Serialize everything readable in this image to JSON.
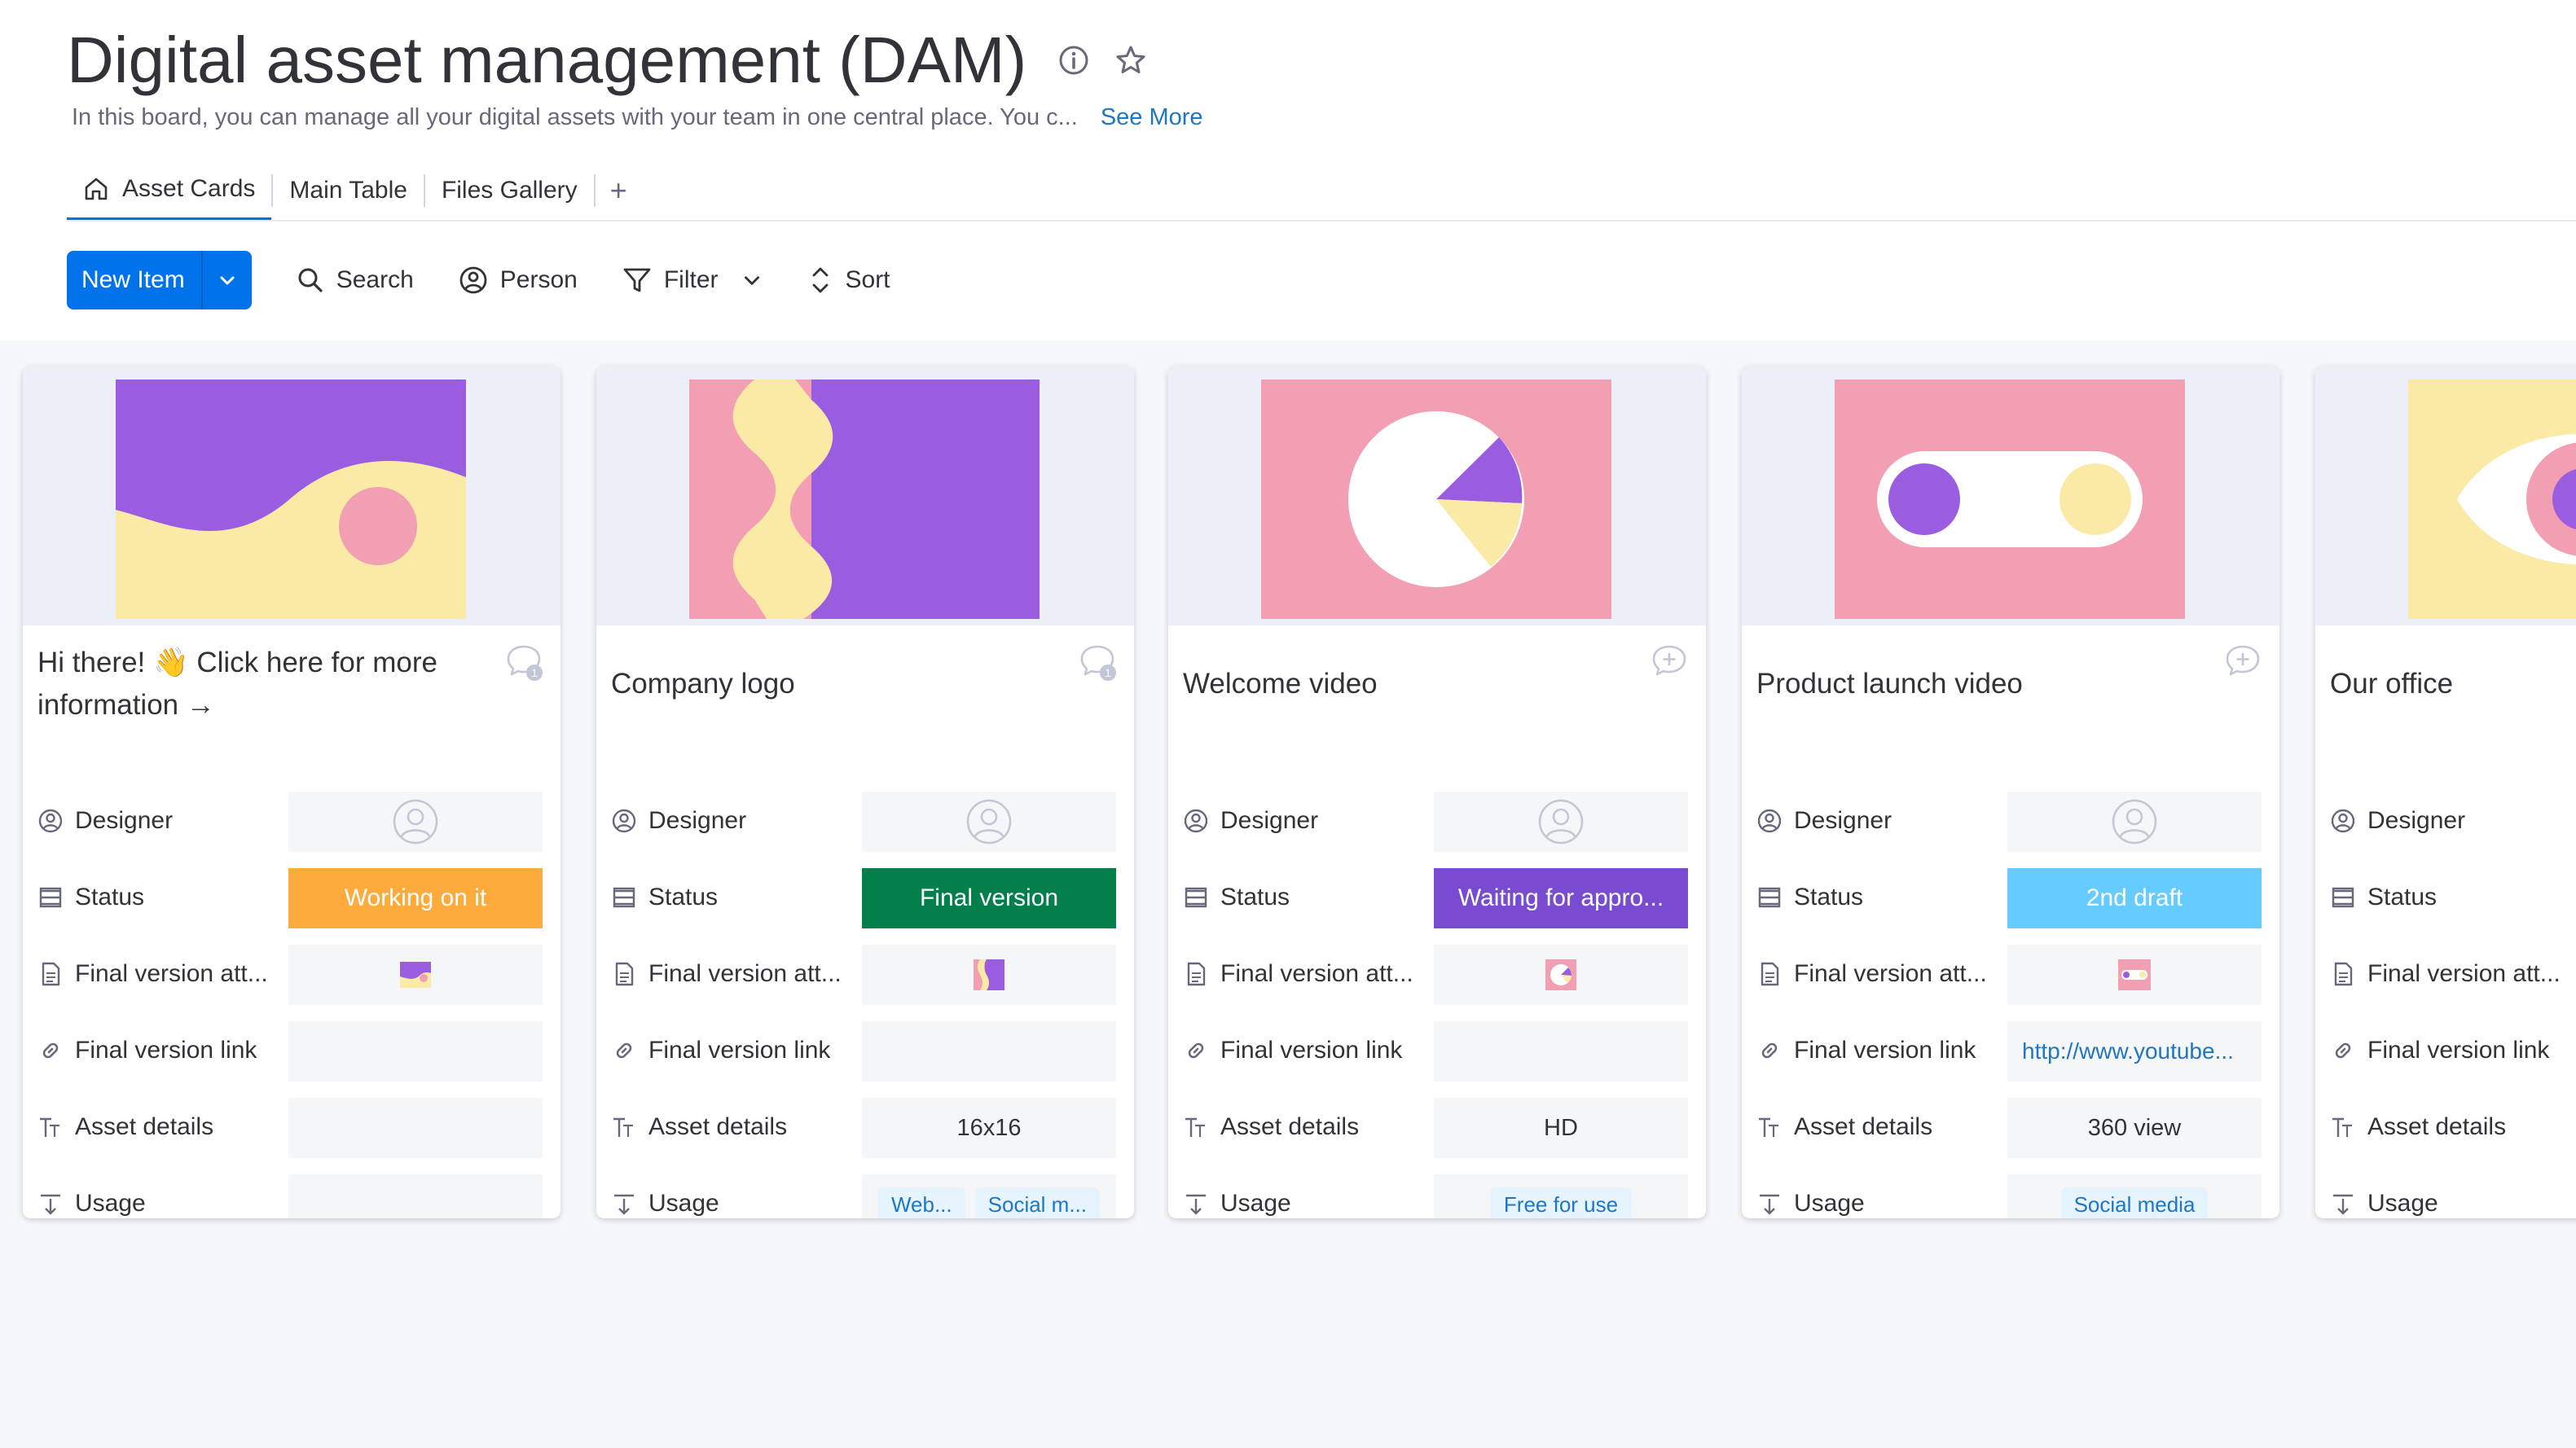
{
  "header": {
    "title": "Digital asset management (DAM)",
    "description": "In this board, you can manage all your digital assets with your team in one central place. You c...",
    "see_more": "See More"
  },
  "tabs": [
    {
      "label": "Asset Cards",
      "active": true
    },
    {
      "label": "Main Table"
    },
    {
      "label": "Files Gallery"
    }
  ],
  "tab_add": "+",
  "toolbar": {
    "new_item": "New Item",
    "search": "Search",
    "person": "Person",
    "filter": "Filter",
    "sort": "Sort"
  },
  "field_labels": {
    "designer": "Designer",
    "status": "Status",
    "file": "Final version att...",
    "link": "Final version link",
    "details": "Asset details",
    "usage": "Usage"
  },
  "cards": [
    {
      "title_pre": "Hi there! ",
      "title_emoji": "👋",
      "title_post": " Click here for more information",
      "title_arrow": "→",
      "updates": "1",
      "status": "Working on it",
      "status_color": "#fdab3d",
      "link": "",
      "details": "",
      "usage": []
    },
    {
      "title": "Company logo",
      "updates": "1",
      "status": "Final version",
      "status_color": "#037f4c",
      "link": "",
      "details": "16x16",
      "usage": [
        "Web...",
        "Social m..."
      ]
    },
    {
      "title": "Welcome video",
      "status": "Waiting for appro...",
      "status_color": "#784bd1",
      "link": "",
      "details": "HD",
      "usage": [
        "Free for use"
      ]
    },
    {
      "title": "Product launch video",
      "status": "2nd draft",
      "status_color": "#66ccff",
      "link": "http://www.youtube...",
      "details": "360 view",
      "usage": [
        "Social media"
      ]
    },
    {
      "title": "Our office"
    }
  ],
  "colors": {
    "purple": "#9b5de0",
    "pink": "#f29fb4",
    "yellow": "#fbeaa6",
    "accent": "#0073ea"
  }
}
